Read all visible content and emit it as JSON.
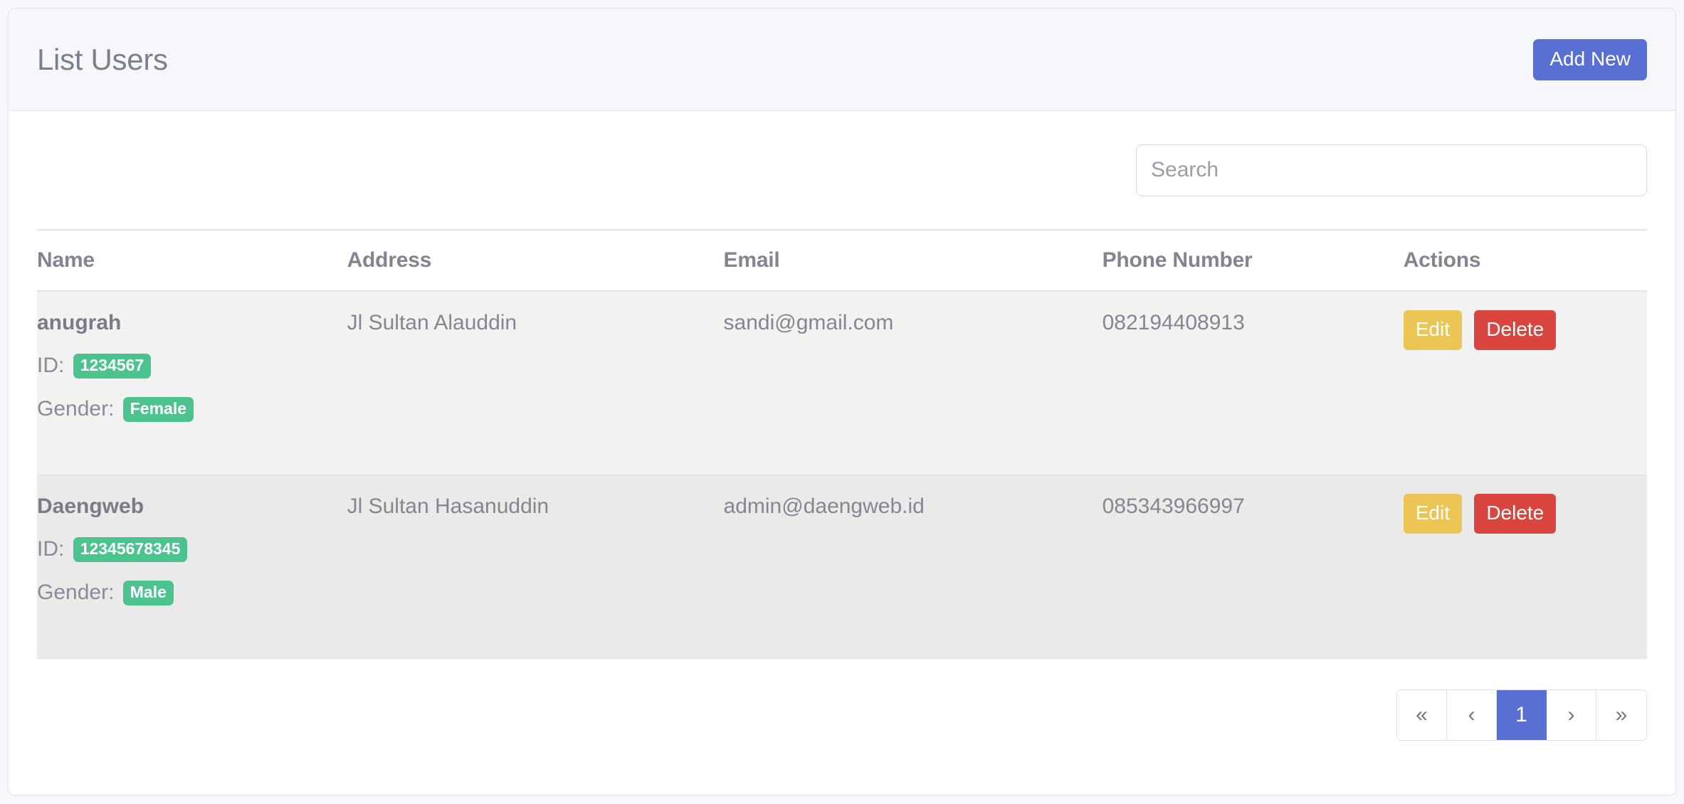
{
  "header": {
    "title": "List Users",
    "add_new_label": "Add New"
  },
  "search": {
    "placeholder": "Search",
    "value": ""
  },
  "table": {
    "columns": [
      "Name",
      "Address",
      "Email",
      "Phone Number",
      "Actions"
    ],
    "meta_labels": {
      "id": "ID:",
      "gender": "Gender:"
    },
    "action_labels": {
      "edit": "Edit",
      "delete": "Delete"
    },
    "rows": [
      {
        "name": "anugrah",
        "address": "Jl Sultan Alauddin",
        "email": "sandi@gmail.com",
        "phone": "082194408913",
        "id": "1234567",
        "gender": "Female"
      },
      {
        "name": "Daengweb",
        "address": "Jl Sultan Hasanuddin",
        "email": "admin@daengweb.id",
        "phone": "085343966997",
        "id": "12345678345",
        "gender": "Male"
      }
    ]
  },
  "pagination": {
    "first": "«",
    "prev": "‹",
    "pages": [
      "1"
    ],
    "active_page": "1",
    "next": "›",
    "last": "»"
  },
  "colors": {
    "accent": "#5a6fd4",
    "badge_green": "#4cc38e",
    "edit_yellow": "#ecc654",
    "delete_red": "#d9453f",
    "page_bg": "#f7f8fc",
    "row_a": "#f2f2f3",
    "row_b": "#eaeaeb"
  }
}
